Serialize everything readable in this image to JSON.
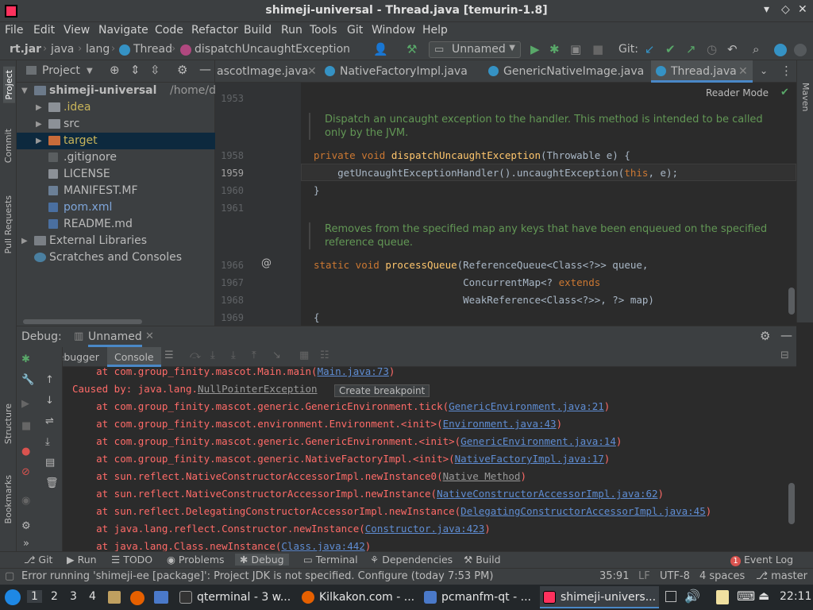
{
  "window": {
    "title": "shimeji-universal - Thread.java [temurin-1.8]"
  },
  "menu": [
    "File",
    "Edit",
    "View",
    "Navigate",
    "Code",
    "Refactor",
    "Build",
    "Run",
    "Tools",
    "Git",
    "Window",
    "Help"
  ],
  "breadcrumb": {
    "jar": "rt.jar",
    "pkg1": "java",
    "pkg2": "lang",
    "cls": "Thread",
    "method": "dispatchUncaughtException"
  },
  "toolbar": {
    "run_config": "Unnamed",
    "git_label": "Git:"
  },
  "project_panel": {
    "title": "Project",
    "root_name": "shimeji-universal",
    "root_path": "/home/dartz",
    "items": [
      ".idea",
      "src",
      "target",
      ".gitignore",
      "LICENSE",
      "MANIFEST.MF",
      "pom.xml",
      "README.md",
      "External Libraries",
      "Scratches and Consoles"
    ]
  },
  "tabs": [
    "ascotImage.java",
    "NativeFactoryImpl.java",
    "GenericNativeImage.java",
    "Thread.java"
  ],
  "editor": {
    "reader_mode": "Reader Mode",
    "line_numbers": [
      "1953",
      "1958",
      "1959",
      "1960",
      "1961",
      "1966",
      "1967",
      "1968",
      "1969"
    ],
    "doc1": "Dispatch an uncaught exception to the handler. This method is intended to be called only by the JVM.",
    "doc2": "Removes from the specified map any keys that have been enqueued on the specified reference queue.",
    "c1958a": "private void ",
    "c1958b": "dispatchUncaughtException",
    "c1958c": "(Throwable e) {",
    "c1959a": "    getUncaughtExceptionHandler().uncaughtException(",
    "c1959b": "this",
    "c1959c": ", e);",
    "c1960": "}",
    "c1966a": "static void ",
    "c1966b": "processQueue",
    "c1966c": "(ReferenceQueue<Class<?>> queue,",
    "c1967a": "                         ConcurrentMap<? ",
    "c1967b": "extends",
    "c1968": "                         WeakReference<Class<?>>, ?> map)",
    "c1969": "{",
    "at_sign": "@"
  },
  "debug": {
    "label": "Debug:",
    "config": "Unnamed",
    "tab_debugger": "Debugger",
    "tab_console": "Console",
    "tooltip": "Create breakpoint",
    "lines": [
      {
        "pre": "    at com.group_finity.mascot.Main.main(",
        "link": "Main.java:73",
        "post": ")"
      },
      {
        "pre": "Caused by: java.lang.",
        "link": "NullPointerException",
        "post": ""
      },
      {
        "pre": "    at com.group_finity.mascot.generic.GenericEnvironment.tick(",
        "link": "GenericEnvironment.java:21",
        "post": ")"
      },
      {
        "pre": "    at com.group_finity.mascot.environment.Environment.<init>(",
        "link": "Environment.java:43",
        "post": ")"
      },
      {
        "pre": "    at com.group_finity.mascot.generic.GenericEnvironment.<init>(",
        "link": "GenericEnvironment.java:14",
        "post": ")"
      },
      {
        "pre": "    at com.group_finity.mascot.generic.NativeFactoryImpl.<init>(",
        "link": "NativeFactoryImpl.java:17",
        "post": ")"
      },
      {
        "pre": "    at sun.reflect.NativeConstructorAccessorImpl.newInstance0(",
        "link": "Native Method",
        "post": ")"
      },
      {
        "pre": "    at sun.reflect.NativeConstructorAccessorImpl.newInstance(",
        "link": "NativeConstructorAccessorImpl.java:62",
        "post": ")"
      },
      {
        "pre": "    at sun.reflect.DelegatingConstructorAccessorImpl.newInstance(",
        "link": "DelegatingConstructorAccessorImpl.java:45",
        "post": ")"
      },
      {
        "pre": "    at java.lang.reflect.Constructor.newInstance(",
        "link": "Constructor.java:423",
        "post": ")"
      },
      {
        "pre": "    at java.lang.Class.newInstance(",
        "link": "Class.java:442",
        "post": ")"
      }
    ]
  },
  "side_tools": {
    "left": [
      "Project",
      "Commit",
      "Pull Requests",
      "Structure",
      "Bookmarks"
    ],
    "right": "Maven"
  },
  "bottom_tools": [
    "Git",
    "Run",
    "TODO",
    "Problems",
    "Debug",
    "Terminal",
    "Dependencies",
    "Build"
  ],
  "event_log": {
    "count": "1",
    "label": "Event Log"
  },
  "status": {
    "message": "Error running 'shimeji-ee [package]': Project JDK is not specified. Configure (today 7:53 PM)",
    "position": "35:91",
    "line_sep": "LF",
    "encoding": "UTF-8",
    "indent": "4 spaces",
    "branch": "master"
  },
  "taskbar": {
    "workspaces": [
      "1",
      "2",
      "3",
      "4"
    ],
    "tasks": [
      "qterminal - 3 w...",
      "Kilkakon.com - ...",
      "pcmanfm-qt - ...",
      "shimeji-univers..."
    ],
    "clock": "22:11"
  },
  "colors": {
    "accent": "#4a88c7",
    "error_text": "#ff6b68",
    "link": "#5f8dd3",
    "doc_comment": "#629755",
    "keyword": "#cc7832",
    "function": "#ffc66d"
  }
}
